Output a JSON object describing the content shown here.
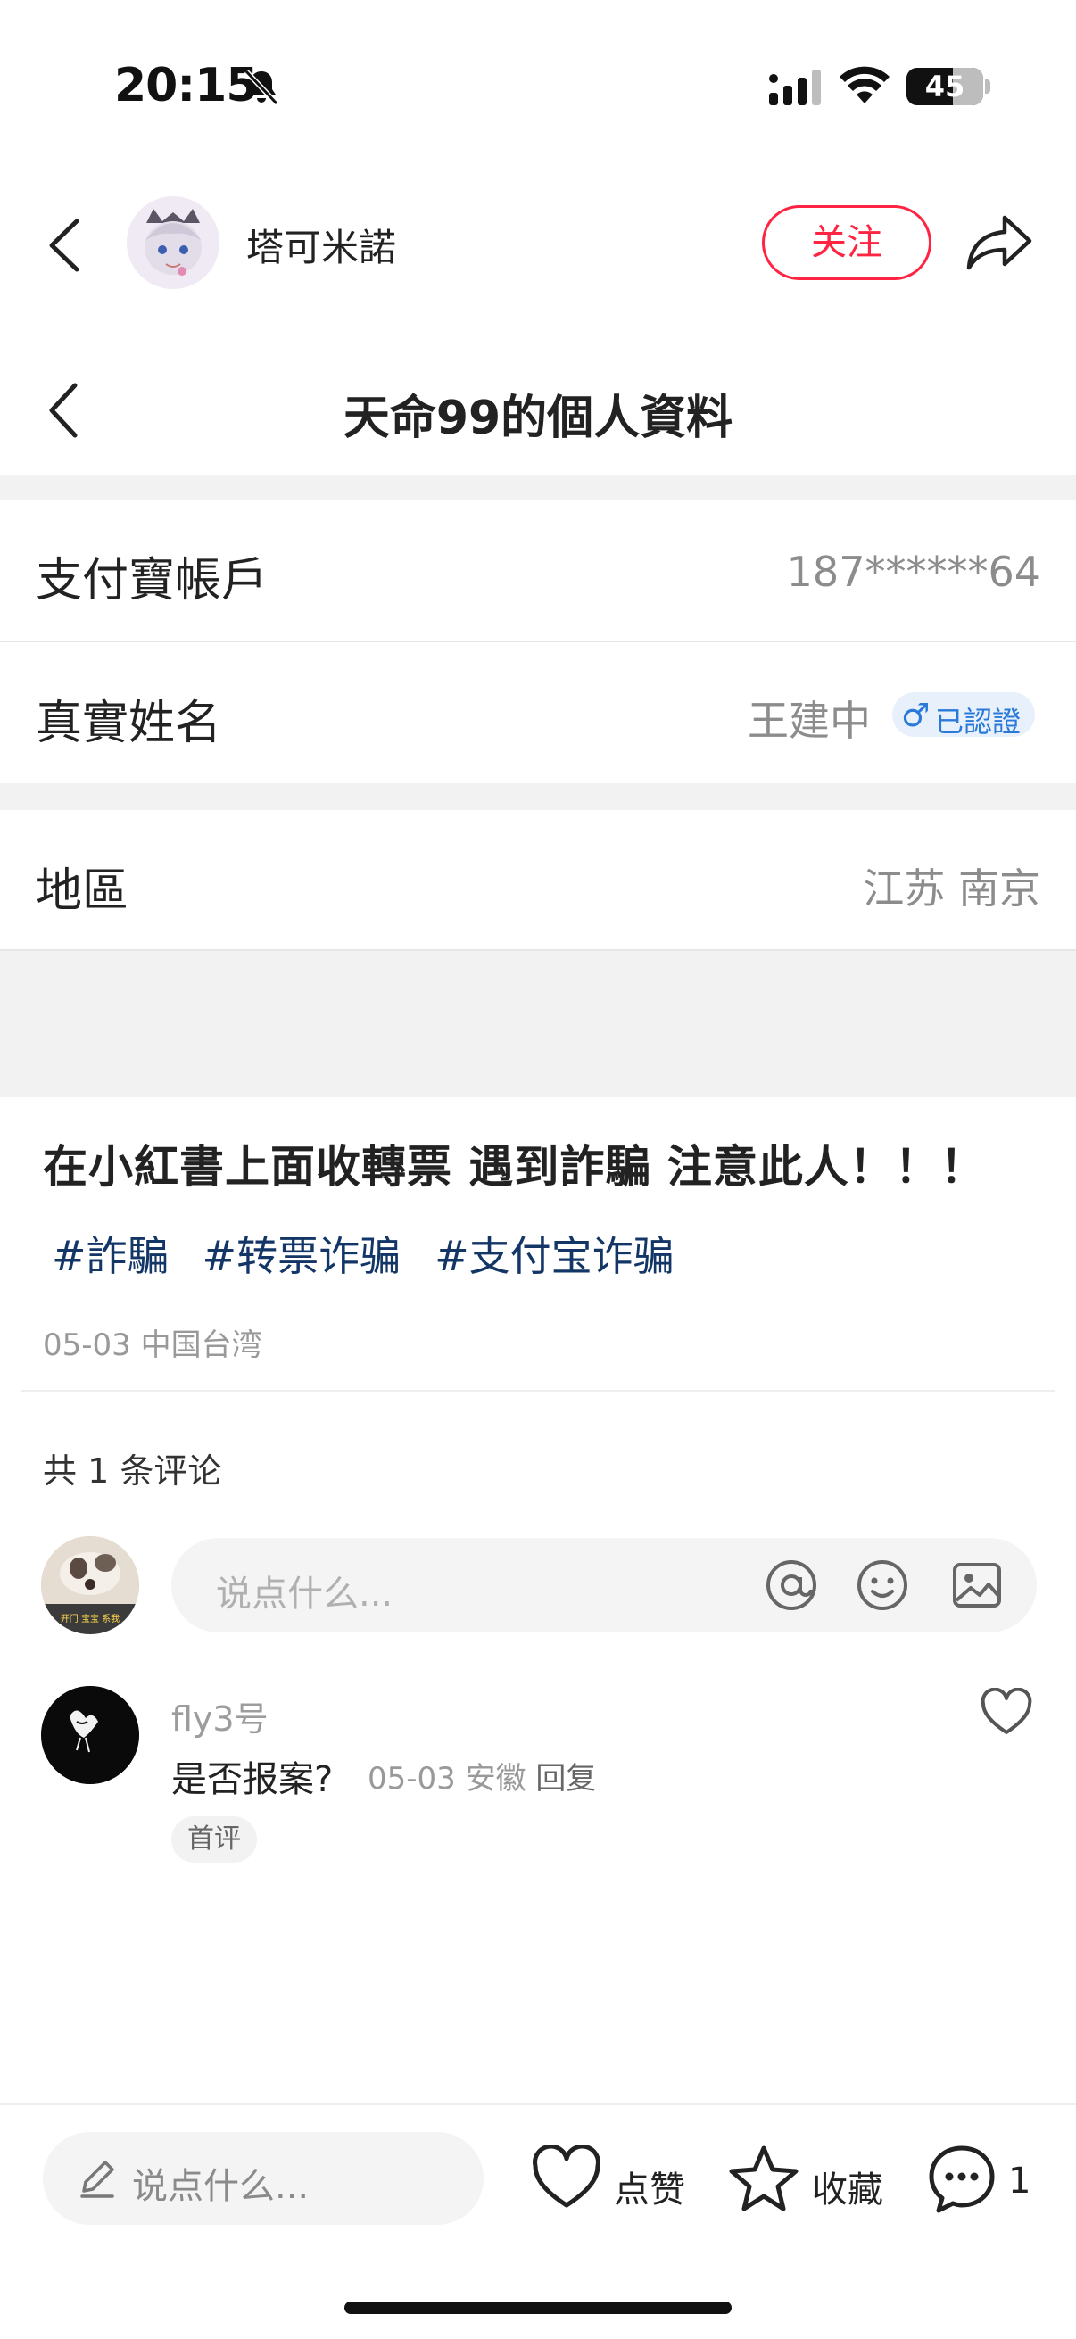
{
  "status_bar": {
    "time": "20:15",
    "battery": "45"
  },
  "header": {
    "author_name": "塔可米諾",
    "follow_label": "关注"
  },
  "post_image": {
    "title": "天命99的個人資料",
    "rows": [
      {
        "label": "支付寶帳戶",
        "value": "187******64"
      },
      {
        "label": "真實姓名",
        "value": "王建中",
        "badge": "已認證",
        "badge_symbol": "♂"
      },
      {
        "label": "地區",
        "value": "江苏 南京"
      }
    ]
  },
  "post": {
    "title": "在小紅書上面收轉票 遇到詐騙 注意此人！！！",
    "tags": [
      "#詐騙",
      "#转票诈骗",
      "#支付宝诈骗"
    ],
    "meta": "05-03 中国台湾"
  },
  "comments_section": {
    "count_label": "共 1 条评论",
    "input_placeholder": "说点什么...",
    "my_avatar_text": "开门 宝宝 系我",
    "comments": [
      {
        "user": "fly3号",
        "text": "是否报案?",
        "date": "05-03",
        "location": "安徽",
        "reply_label": "回复",
        "badge": "首评"
      }
    ]
  },
  "bottom_bar": {
    "input_placeholder": "说点什么...",
    "like_label": "点赞",
    "collect_label": "收藏",
    "comment_count": "1"
  },
  "colors": {
    "accent": "#ff2442",
    "tag": "#133667",
    "verified": "#2979d8"
  }
}
